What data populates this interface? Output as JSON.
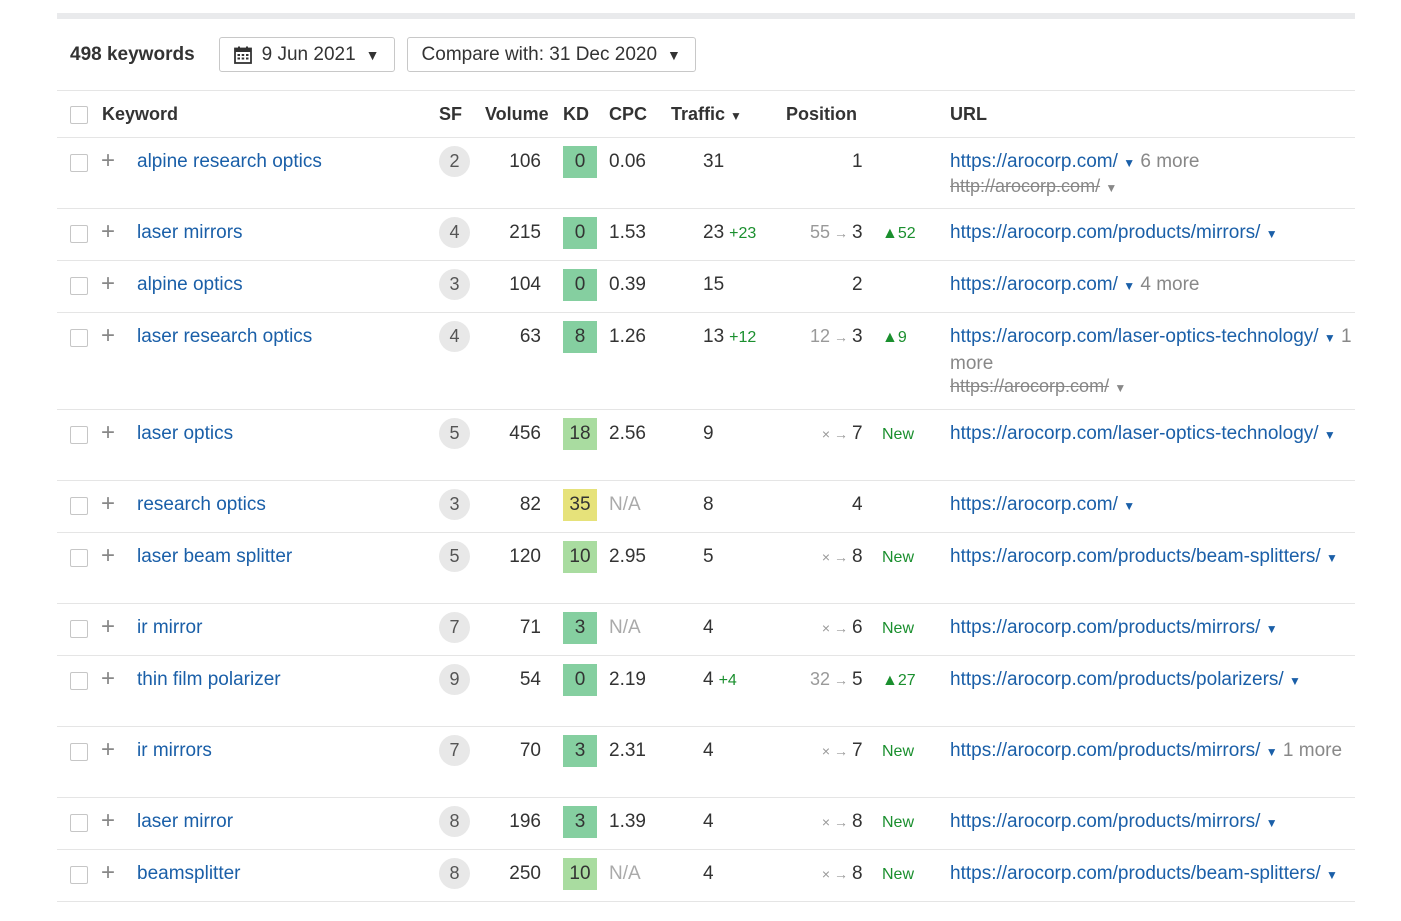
{
  "toolbar": {
    "keyword_count": "498 keywords",
    "date": "9 Jun 2021",
    "compare": "Compare with: 31 Dec 2020"
  },
  "columns": {
    "keyword": "Keyword",
    "sf": "SF",
    "volume": "Volume",
    "kd": "KD",
    "cpc": "CPC",
    "traffic": "Traffic",
    "position": "Position",
    "url": "URL"
  },
  "rows": [
    {
      "keyword": "alpine research optics",
      "sf": "2",
      "volume": "106",
      "kd": "0",
      "kd_color": "#85cfa0",
      "cpc": "0.06",
      "traffic": "31",
      "traffic_delta": "",
      "pos_old": "",
      "pos_new": "1",
      "pos_change": "",
      "url": "https://arocorp.com/",
      "more": "6 more",
      "old_url": "http://arocorp.com/"
    },
    {
      "keyword": "laser mirrors",
      "sf": "4",
      "volume": "215",
      "kd": "0",
      "kd_color": "#85cfa0",
      "cpc": "1.53",
      "traffic": "23",
      "traffic_delta": "+23",
      "pos_old": "55",
      "pos_new": "3",
      "pos_change": "▲52",
      "url": "https://arocorp.com/products/mirrors/",
      "more": "",
      "old_url": ""
    },
    {
      "keyword": "alpine optics",
      "sf": "3",
      "volume": "104",
      "kd": "0",
      "kd_color": "#85cfa0",
      "cpc": "0.39",
      "traffic": "15",
      "traffic_delta": "",
      "pos_old": "",
      "pos_new": "2",
      "pos_change": "",
      "url": "https://arocorp.com/",
      "more": "4 more",
      "old_url": ""
    },
    {
      "keyword": "laser research optics",
      "sf": "4",
      "volume": "63",
      "kd": "8",
      "kd_color": "#85cfa0",
      "cpc": "1.26",
      "traffic": "13",
      "traffic_delta": "+12",
      "pos_old": "12",
      "pos_new": "3",
      "pos_change": "▲9",
      "url": "https://arocorp.com/laser-optics-technology/",
      "more": "1 more",
      "old_url": "https://arocorp.com/"
    },
    {
      "keyword": "laser optics",
      "sf": "5",
      "volume": "456",
      "kd": "18",
      "kd_color": "#a9dca0",
      "cpc": "2.56",
      "traffic": "9",
      "traffic_delta": "",
      "pos_old": "×",
      "pos_new": "7",
      "pos_change": "New",
      "url": "https://arocorp.com/laser-optics-technology/",
      "more": "",
      "old_url": ""
    },
    {
      "keyword": "research optics",
      "sf": "3",
      "volume": "82",
      "kd": "35",
      "kd_color": "#e6e27a",
      "cpc": "N/A",
      "traffic": "8",
      "traffic_delta": "",
      "pos_old": "",
      "pos_new": "4",
      "pos_change": "",
      "url": "https://arocorp.com/",
      "more": "",
      "old_url": ""
    },
    {
      "keyword": "laser beam splitter",
      "sf": "5",
      "volume": "120",
      "kd": "10",
      "kd_color": "#a9dca0",
      "cpc": "2.95",
      "traffic": "5",
      "traffic_delta": "",
      "pos_old": "×",
      "pos_new": "8",
      "pos_change": "New",
      "url": "https://arocorp.com/products/beam-splitters/",
      "more": "",
      "old_url": ""
    },
    {
      "keyword": "ir mirror",
      "sf": "7",
      "volume": "71",
      "kd": "3",
      "kd_color": "#85cfa0",
      "cpc": "N/A",
      "traffic": "4",
      "traffic_delta": "",
      "pos_old": "×",
      "pos_new": "6",
      "pos_change": "New",
      "url": "https://arocorp.com/products/mirrors/",
      "more": "",
      "old_url": ""
    },
    {
      "keyword": "thin film polarizer",
      "sf": "9",
      "volume": "54",
      "kd": "0",
      "kd_color": "#85cfa0",
      "cpc": "2.19",
      "traffic": "4",
      "traffic_delta": "+4",
      "pos_old": "32",
      "pos_new": "5",
      "pos_change": "▲27",
      "url": "https://arocorp.com/products/polarizers/",
      "more": "",
      "old_url": ""
    },
    {
      "keyword": "ir mirrors",
      "sf": "7",
      "volume": "70",
      "kd": "3",
      "kd_color": "#85cfa0",
      "cpc": "2.31",
      "traffic": "4",
      "traffic_delta": "",
      "pos_old": "×",
      "pos_new": "7",
      "pos_change": "New",
      "url": "https://arocorp.com/products/mirrors/",
      "more": "1 more",
      "old_url": ""
    },
    {
      "keyword": "laser mirror",
      "sf": "8",
      "volume": "196",
      "kd": "3",
      "kd_color": "#85cfa0",
      "cpc": "1.39",
      "traffic": "4",
      "traffic_delta": "",
      "pos_old": "×",
      "pos_new": "8",
      "pos_change": "New",
      "url": "https://arocorp.com/products/mirrors/",
      "more": "",
      "old_url": ""
    },
    {
      "keyword": "beamsplitter",
      "sf": "8",
      "volume": "250",
      "kd": "10",
      "kd_color": "#a9dca0",
      "cpc": "N/A",
      "traffic": "4",
      "traffic_delta": "",
      "pos_old": "×",
      "pos_new": "8",
      "pos_change": "New",
      "url": "https://arocorp.com/products/beam-splitters/",
      "more": "",
      "old_url": ""
    }
  ]
}
